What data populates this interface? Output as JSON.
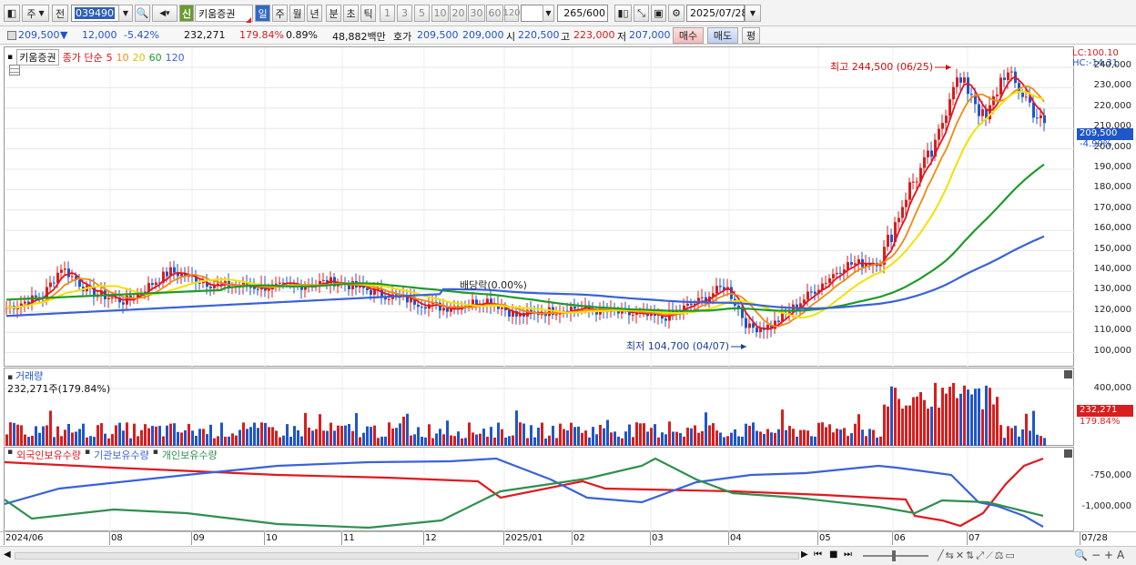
{
  "toolbar": {
    "period": "주",
    "type_sel": "전",
    "code": "039490",
    "shin": "신",
    "stock_name": "키움증권",
    "tab_day": "일",
    "tab_week": "주",
    "tab_month": "월",
    "tab_year": "년",
    "tab_min": "분",
    "tab_sec": "초",
    "tab_tick": "틱",
    "ticks": [
      "1",
      "3",
      "5",
      "10",
      "20",
      "30",
      "60",
      "120"
    ],
    "count": "265",
    "count_total": "/600",
    "date": "2025/07/28"
  },
  "quote": {
    "price": "209,500",
    "change_arrow": "▼",
    "change": "12,000",
    "change_pct": "-5.42%",
    "volume": "232,271",
    "vol_ratio": "179.84%",
    "turnover": "0.89%",
    "amount": "48,882백만",
    "hoga_label": "호가",
    "bid": "209,500",
    "ask": "209,000",
    "open_label": "시",
    "open": "220,500",
    "high_label": "고",
    "high": "223,000",
    "low_label": "저",
    "low": "207,000",
    "buy_label": "매수",
    "sell_label": "매도",
    "other_label": "평"
  },
  "price_panel": {
    "name": "키움증권",
    "legend_title": "종가 단순",
    "ma": [
      {
        "label": "5",
        "color": "#e8121e"
      },
      {
        "label": "10",
        "color": "#f08a14"
      },
      {
        "label": "20",
        "color": "#f2e200"
      },
      {
        "label": "60",
        "color": "#1f9a2a"
      },
      {
        "label": "120",
        "color": "#3a62d8"
      }
    ],
    "lc": "LC:100.10",
    "hc": "HC:-14.31",
    "high_marker": "최고 244,500 (06/25)",
    "low_marker": "최저 104,700 (04/07)",
    "dividend": "배당락(0.00%)",
    "current_price": "209,500",
    "current_pct": "-4.99%",
    "y_labels": [
      "240,000",
      "230,000",
      "220,000",
      "210,000",
      "200,000",
      "190,000",
      "180,000",
      "170,000",
      "160,000",
      "150,000",
      "140,000",
      "130,000",
      "120,000",
      "110,000",
      "100,000"
    ]
  },
  "volume_panel": {
    "title": "거래량",
    "value": "232,271주(179.84%)",
    "y_label": "400,000",
    "cur": "232,271",
    "cur_pct": "179.84%"
  },
  "holding_panel": {
    "items": [
      "외국인보유수량",
      "기관보유수량",
      "개인보유수량"
    ],
    "y_labels": [
      "-750,000",
      "-1,000,000"
    ]
  },
  "x_axis": [
    "2024/06",
    "08",
    "09",
    "10",
    "11",
    "12",
    "2025/01",
    "02",
    "03",
    "04",
    "05",
    "06",
    "07",
    "07/28"
  ],
  "colors": {
    "up": "#d81e1e",
    "down": "#1f56c8",
    "ma5": "#e8121e",
    "ma10": "#f08a14",
    "ma20": "#f2e200",
    "ma60": "#1f9a2a",
    "ma120": "#3a62d8",
    "foreign": "#e0191e",
    "inst": "#3a62d8",
    "retail": "#2f8f4f"
  }
}
